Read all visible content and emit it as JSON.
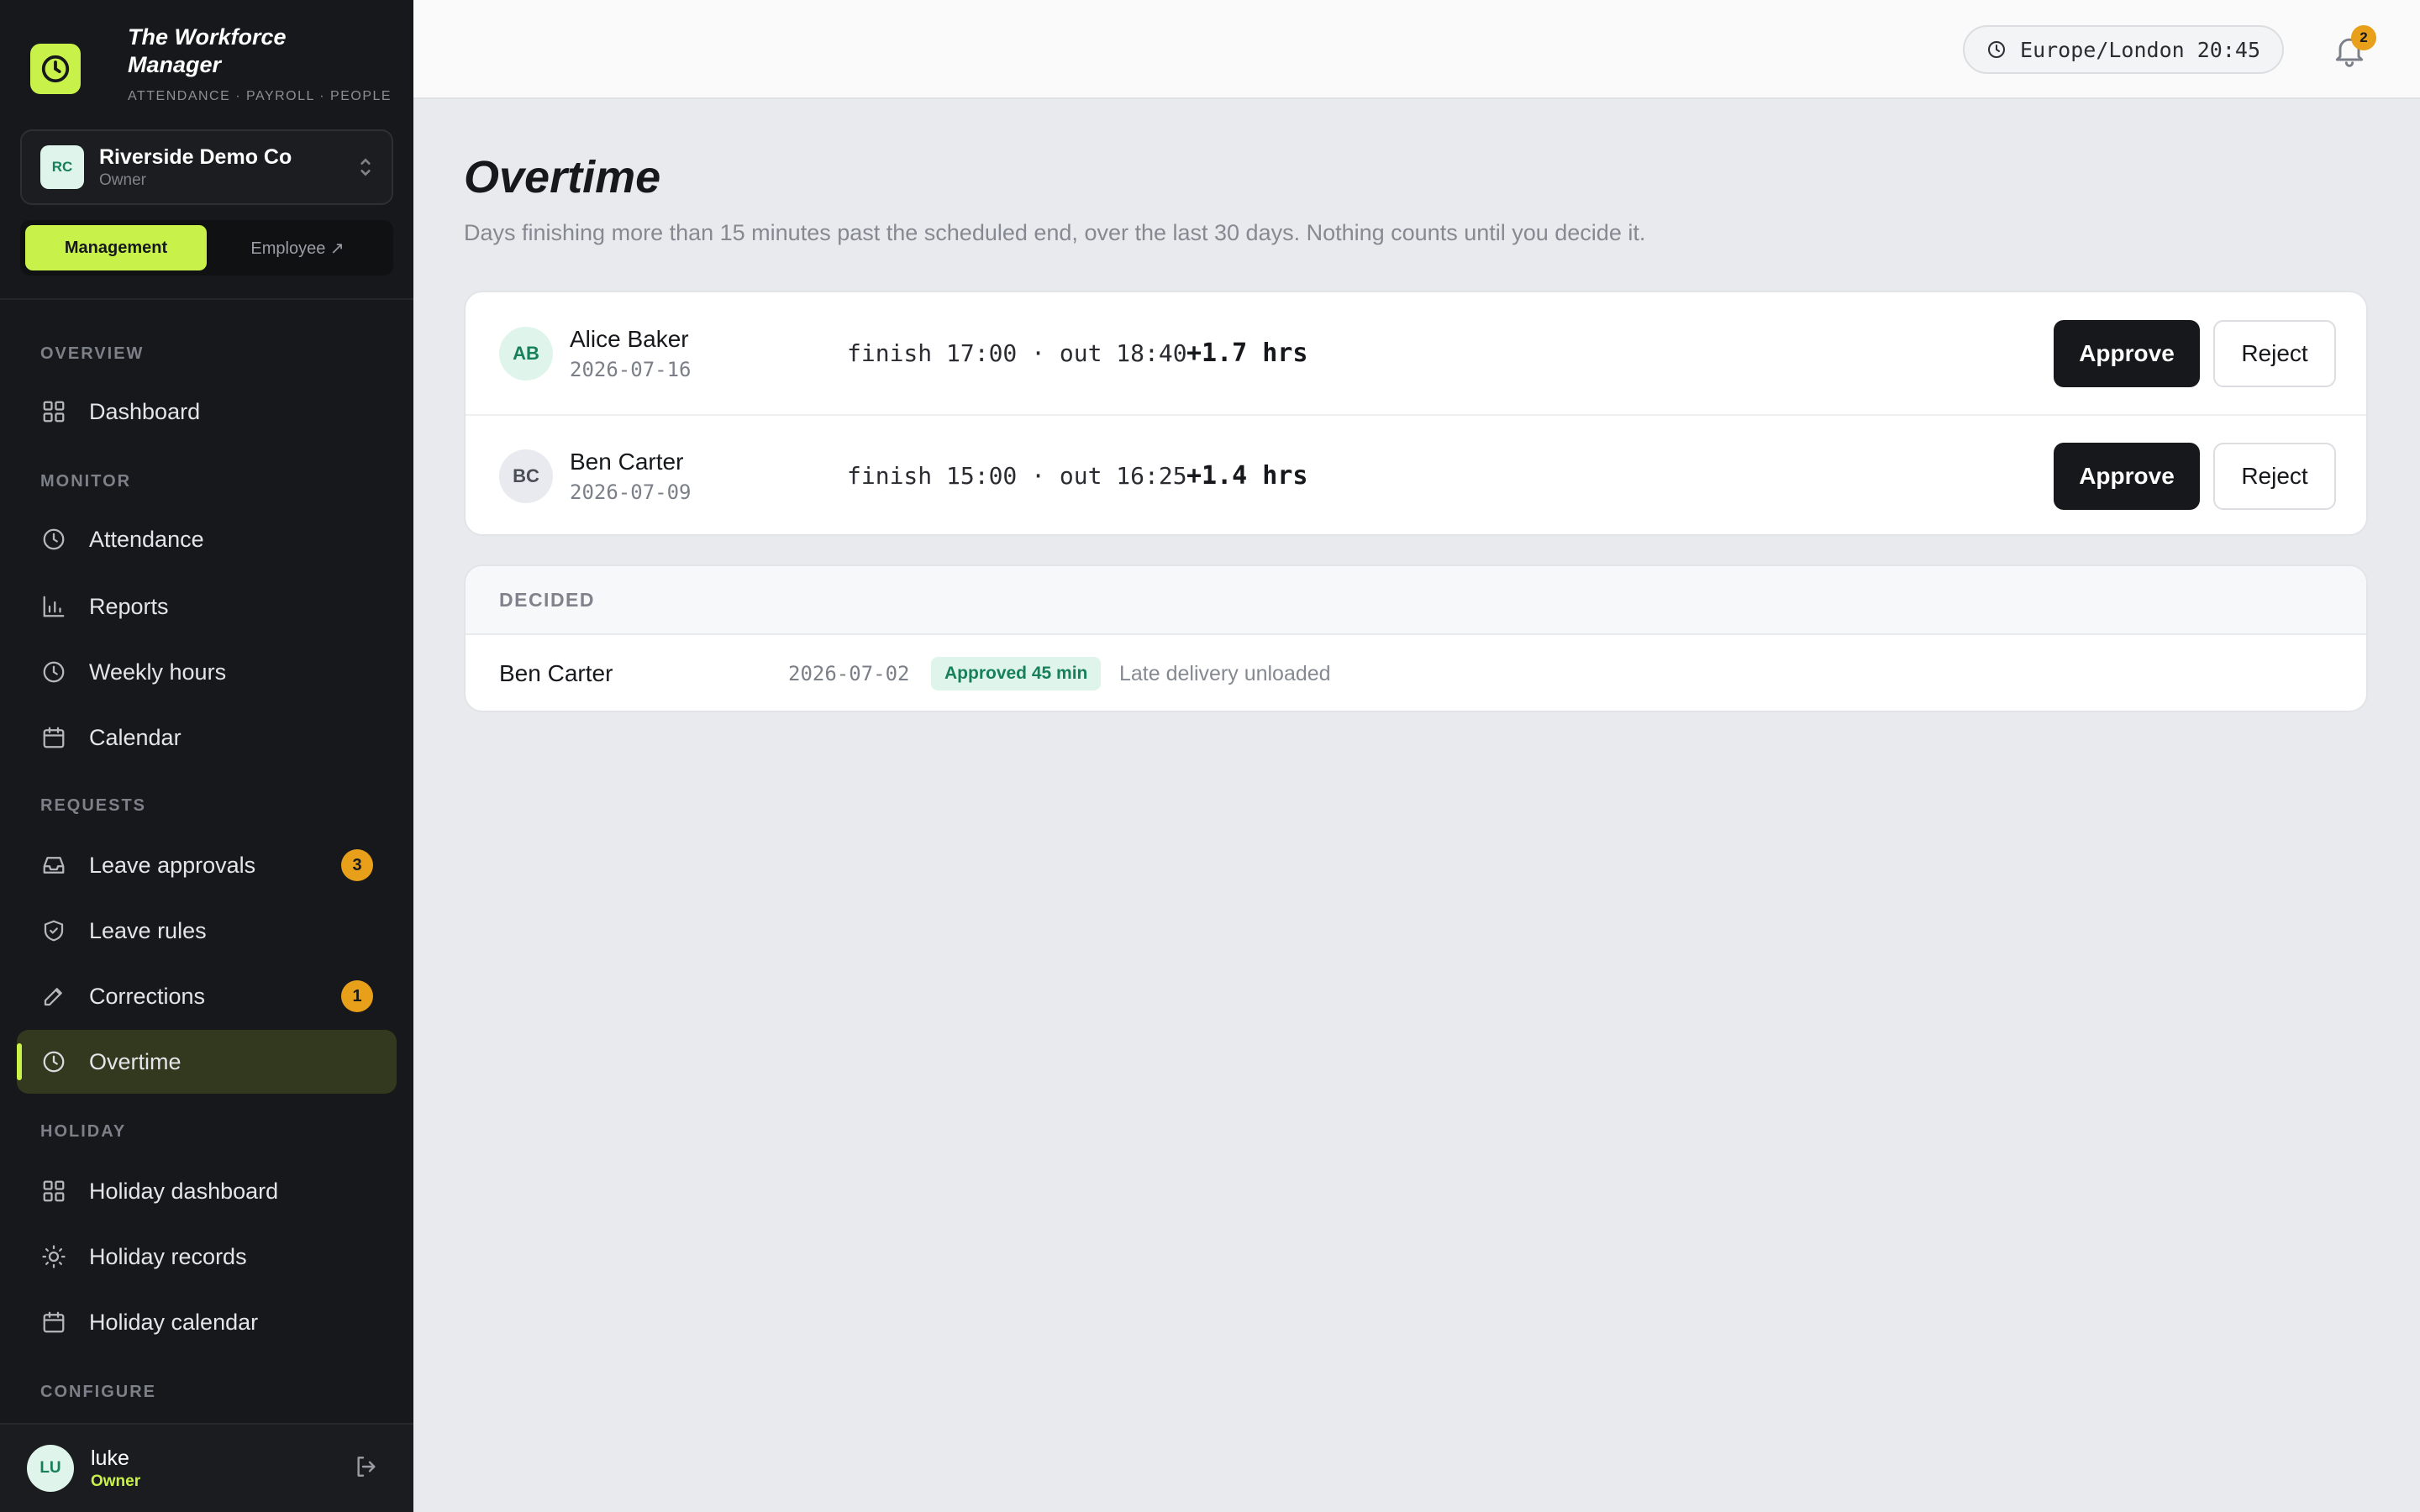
{
  "brand": {
    "title_line1": "The Workforce",
    "title_line2": "Manager",
    "subtitle": "ATTENDANCE · PAYROLL · PEOPLE"
  },
  "company": {
    "initials": "RC",
    "name": "Riverside Demo Co",
    "role": "Owner"
  },
  "mode_switch": {
    "management": "Management",
    "employee": "Employee ↗",
    "active": "management"
  },
  "sidebar": {
    "sections": {
      "overview": "OVERVIEW",
      "monitor": "MONITOR",
      "requests": "REQUESTS",
      "holiday": "HOLIDAY",
      "configure": "CONFIGURE"
    },
    "items": {
      "dashboard": {
        "label": "Dashboard",
        "icon": "grid-icon"
      },
      "attendance": {
        "label": "Attendance",
        "icon": "clock-icon"
      },
      "reports": {
        "label": "Reports",
        "icon": "bar-chart-icon"
      },
      "weekly_hours": {
        "label": "Weekly hours",
        "icon": "clock-icon"
      },
      "calendar": {
        "label": "Calendar",
        "icon": "calendar-icon"
      },
      "leave_approvals": {
        "label": "Leave approvals",
        "icon": "inbox-icon",
        "badge": "3"
      },
      "leave_rules": {
        "label": "Leave rules",
        "icon": "shield-check-icon"
      },
      "corrections": {
        "label": "Corrections",
        "icon": "pencil-icon",
        "badge": "1"
      },
      "overtime": {
        "label": "Overtime",
        "icon": "clock-icon",
        "active": true
      },
      "holiday_dashboard": {
        "label": "Holiday dashboard",
        "icon": "grid-icon"
      },
      "holiday_records": {
        "label": "Holiday records",
        "icon": "sun-icon"
      },
      "holiday_calendar": {
        "label": "Holiday calendar",
        "icon": "calendar-icon"
      }
    }
  },
  "user": {
    "initials": "LU",
    "name": "luke",
    "role": "Owner"
  },
  "topbar": {
    "timezone": "Europe/London 20:45",
    "notifications": "2"
  },
  "page": {
    "title": "Overtime",
    "description": "Days finishing more than 15 minutes past the scheduled end, over the last 30 days. Nothing counts until you decide it."
  },
  "pending": [
    {
      "initials": "AB",
      "name": "Alice Baker",
      "date": "2026-07-16",
      "times": "finish 17:00 · out 18:40",
      "extra": "+1.7 hrs",
      "approve": "Approve",
      "reject": "Reject"
    },
    {
      "initials": "BC",
      "name": "Ben Carter",
      "date": "2026-07-09",
      "times": "finish 15:00 · out 16:25",
      "extra": "+1.4 hrs",
      "approve": "Approve",
      "reject": "Reject"
    }
  ],
  "decided": {
    "heading": "DECIDED",
    "rows": [
      {
        "name": "Ben Carter",
        "date": "2026-07-02",
        "status": "Approved 45 min",
        "note": "Late delivery unloaded"
      }
    ]
  },
  "colors": {
    "accent": "#c8f24a",
    "sidebar_bg": "#17181b",
    "badge": "#e8a01b",
    "success": "#17805a"
  }
}
